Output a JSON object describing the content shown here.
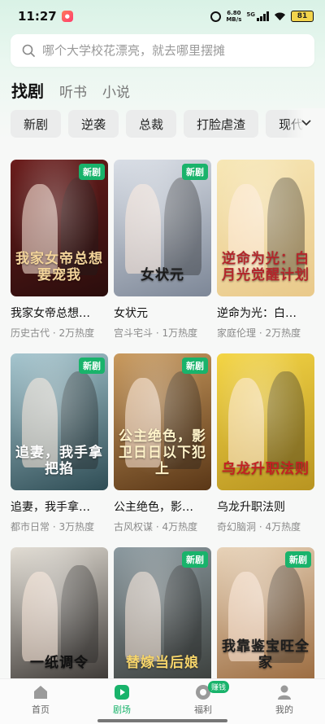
{
  "status_bar": {
    "time": "11:27",
    "net_speed_value": "6.80",
    "net_speed_unit": "MB/s",
    "network": "5G",
    "battery": "81"
  },
  "search": {
    "placeholder": "哪个大学校花漂亮，就去哪里摆摊"
  },
  "tabs": [
    {
      "label": "找剧",
      "active": true
    },
    {
      "label": "听书",
      "active": false
    },
    {
      "label": "小说",
      "active": false
    }
  ],
  "categories": [
    "新剧",
    "逆袭",
    "总裁",
    "打脸虐渣",
    "现代"
  ],
  "new_badge": "新剧",
  "dramas": [
    {
      "title": "我家女帝总想…",
      "meta": "历史古代 · 2万热度",
      "poster_text": "我家女帝总想要宠我",
      "is_new": true,
      "colors": [
        "#6b1d1c",
        "#2a0d0c"
      ],
      "text_color": "#f3d49a"
    },
    {
      "title": "女状元",
      "meta": "宫斗宅斗 · 1万热度",
      "poster_text": "女状元",
      "is_new": true,
      "colors": [
        "#d9dee6",
        "#7d8797"
      ],
      "text_color": "#1b1b1b"
    },
    {
      "title": "逆命为光：白…",
      "meta": "家庭伦理 · 2万热度",
      "poster_text": "逆命为光：白月光觉醒计划",
      "is_new": false,
      "colors": [
        "#f7e7b6",
        "#e9c98a"
      ],
      "text_color": "#b3272b"
    },
    {
      "title": "追妻，我手拿…",
      "meta": "都市日常 · 3万热度",
      "poster_text": "追妻，我手拿把掐",
      "is_new": true,
      "colors": [
        "#a6c6cf",
        "#2f4d55"
      ],
      "text_color": "#ffffff"
    },
    {
      "title": "公主绝色，影…",
      "meta": "古风权谋 · 4万热度",
      "poster_text": "公主绝色，影卫日日以下犯上",
      "is_new": true,
      "colors": [
        "#c99a5e",
        "#5a3717"
      ],
      "text_color": "#fff3c9"
    },
    {
      "title": "乌龙升职法则",
      "meta": "奇幻脑洞 · 4万热度",
      "poster_text": "乌龙升职法则",
      "is_new": false,
      "colors": [
        "#f4d545",
        "#b89421"
      ],
      "text_color": "#c32222"
    },
    {
      "title": "",
      "meta": "",
      "poster_text": "一纸调令",
      "is_new": false,
      "colors": [
        "#e2ddd4",
        "#3a3633"
      ],
      "text_color": "#111111"
    },
    {
      "title": "",
      "meta": "",
      "poster_text": "替嫁当后娘",
      "is_new": true,
      "colors": [
        "#8c9aa0",
        "#3b3f3c"
      ],
      "text_color": "#f5d46a"
    },
    {
      "title": "",
      "meta": "",
      "poster_text": "我靠鉴宝旺全家",
      "is_new": true,
      "colors": [
        "#e8d3b9",
        "#9a6a3e"
      ],
      "text_color": "#1d1d1d"
    }
  ],
  "bottom_nav": [
    {
      "label": "首页",
      "icon": "home-icon",
      "active": false
    },
    {
      "label": "剧场",
      "icon": "play-icon",
      "active": true
    },
    {
      "label": "福利",
      "icon": "coin-icon",
      "active": false,
      "badge": "赚钱"
    },
    {
      "label": "我的",
      "icon": "user-icon",
      "active": false
    }
  ],
  "accent_color": "#19b36b"
}
